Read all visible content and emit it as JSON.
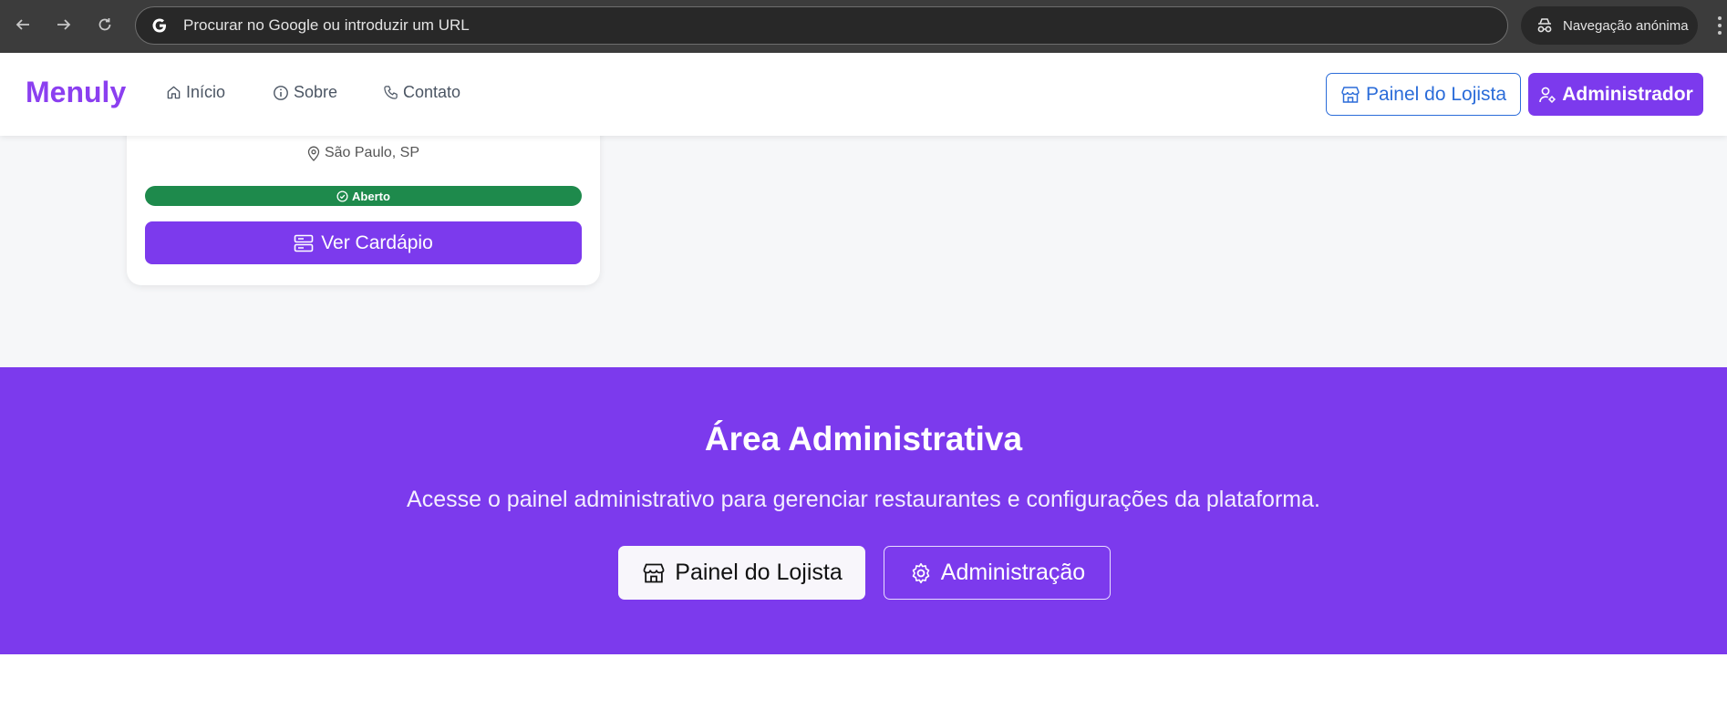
{
  "browser": {
    "omnibox_text": "Procurar no Google ou introduzir um URL",
    "incognito_label": "Navegação anónima"
  },
  "header": {
    "logo": "Menuly",
    "nav": [
      {
        "label": "Início",
        "icon": "home-icon"
      },
      {
        "label": "Sobre",
        "icon": "info-icon"
      },
      {
        "label": "Contato",
        "icon": "phone-icon"
      }
    ],
    "merchant_button": "Painel do Lojista",
    "admin_button": "Administrador"
  },
  "restaurant_card": {
    "location": "São Paulo, SP",
    "status": "Aberto",
    "status_color": "#1e8a4c",
    "menu_button": "Ver Cardápio"
  },
  "admin_section": {
    "title": "Área Administrativa",
    "subtitle": "Acesse o painel administrativo para gerenciar restaurantes e configurações da plataforma.",
    "merchant_button": "Painel do Lojista",
    "admin_button": "Administração",
    "background_color": "#7c3aed"
  },
  "colors": {
    "brand_purple": "#7c3aed",
    "link_blue": "#2b6cd9"
  }
}
